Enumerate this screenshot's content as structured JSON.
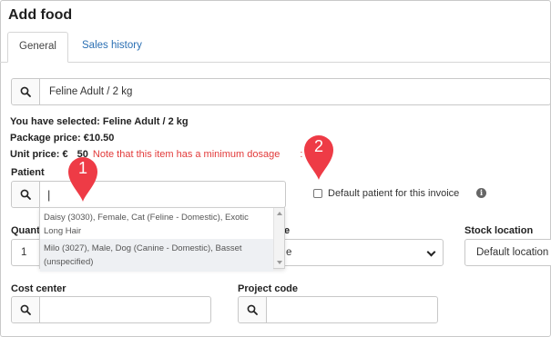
{
  "page": {
    "title": "Add food"
  },
  "tabs": [
    {
      "label": "General"
    },
    {
      "label": "Sales history"
    }
  ],
  "product_search": {
    "value": "Feline Adult / 2 kg"
  },
  "selection": {
    "selected_label": "You have selected: Feline Adult / 2 kg",
    "package_price_label": "Package price: €10.50",
    "unit_price_prefix": "Unit price: €",
    "unit_price_tail": "50",
    "min_dosage_note_a": "Note that this item has a minimum dosage",
    "min_dosage_note_b": ": 1."
  },
  "patient": {
    "label": "Patient",
    "input_value": "|",
    "options": [
      {
        "text": "Daisy (3030), Female, Cat (Feline - Domestic), Exotic Long Hair"
      },
      {
        "text": "Milo (3027), Male, Dog (Canine - Domestic), Basset (unspecified)"
      }
    ],
    "default_checkbox_label": "Default patient for this invoice",
    "default_checked": false
  },
  "quantity": {
    "label": "Quant",
    "value": "1"
  },
  "middle_select": {
    "label_tail": "e",
    "value_tail": "e"
  },
  "stock_location": {
    "label": "Stock location",
    "value": "Default location"
  },
  "cost_center": {
    "label": "Cost center",
    "value": ""
  },
  "project_code": {
    "label": "Project code",
    "value": ""
  },
  "callouts": [
    {
      "number": "1",
      "color": "#ee3b46"
    },
    {
      "number": "2",
      "color": "#ee3b46"
    }
  ]
}
